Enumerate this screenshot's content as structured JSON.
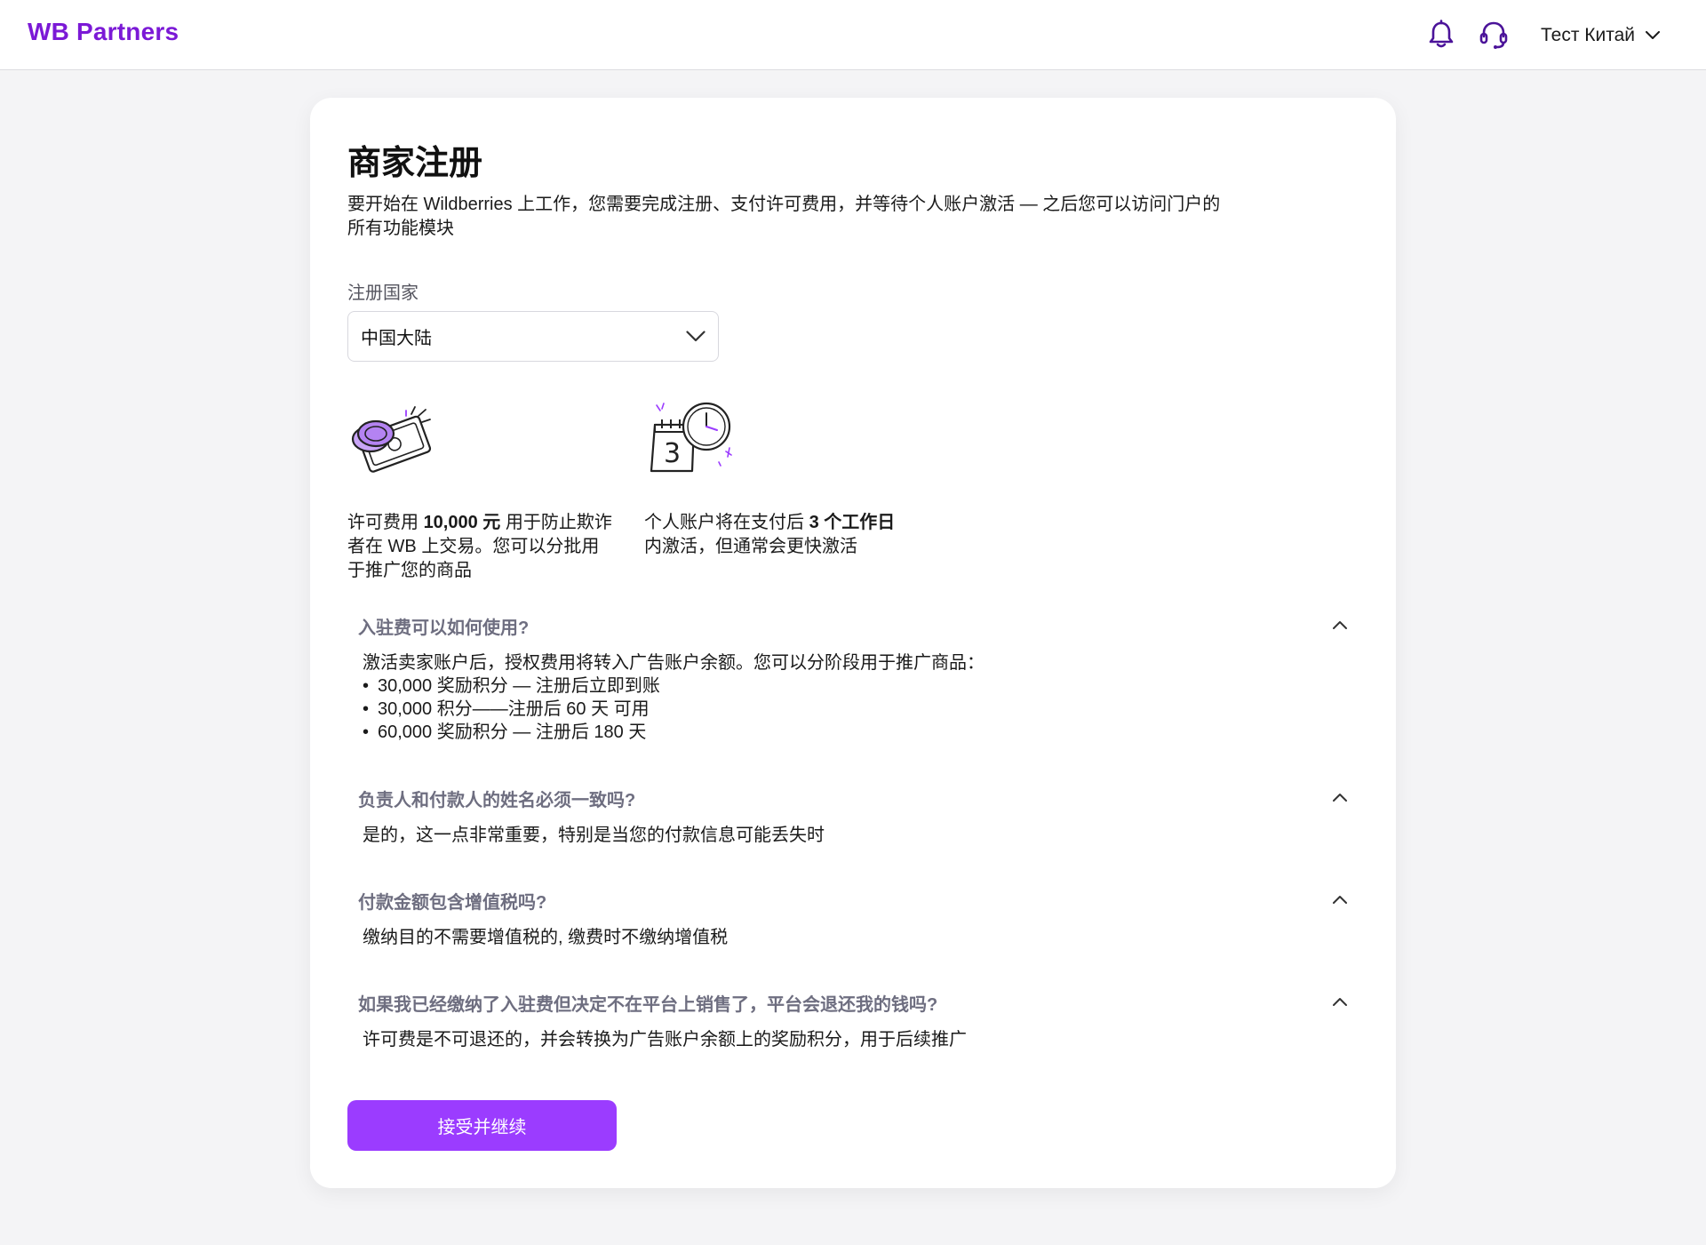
{
  "header": {
    "logo": "WB Partners",
    "user_name": "Тест Китай",
    "icons": [
      "bell-icon",
      "headset-support-icon",
      "chevron-down-icon"
    ]
  },
  "card": {
    "title": "商家注册",
    "intro": "要开始在 Wildberries 上工作，您需要完成注册、支付许可费用，并等待个人账户激活 — 之后您可以访问门户的所有功能模块",
    "country_label": "注册国家",
    "country_value": "中国大陆",
    "features": [
      {
        "icon": "coin-banknote-icon",
        "text_a": "许可费用 ",
        "text_b": "10,000 元",
        "text_c": " 用于防止欺诈者在 WB 上交易。您可以分批用于推广您的商品"
      },
      {
        "icon": "calendar-clock-icon",
        "text_a": "个人账户将在支付后 ",
        "text_b": "3 个工作日",
        "text_c": " 内激活，但通常会更快激活"
      }
    ],
    "faq": [
      {
        "question": "入驻费可以如何使用?",
        "answer_lead": "激活卖家账户后，授权费用将转入广告账户余额。您可以分阶段用于推广商品：",
        "answer_items": [
          "30,000 奖励积分 — 注册后立即到账",
          "30,000 积分——注册后 60 天 可用",
          "60,000 奖励积分 — 注册后 180 天"
        ]
      },
      {
        "question": "负责人和付款人的姓名必须一致吗?",
        "answer_lead": "是的，这一点非常重要，特别是当您的付款信息可能丢失时"
      },
      {
        "question": "付款金额包含增值税吗?",
        "answer_lead": "缴纳目的不需要增值税的, 缴费时不缴纳增值税"
      },
      {
        "question": "如果我已经缴纳了入驻费但决定不在平台上销售了，平台会退还我的钱吗?",
        "answer_lead": "许可费是不可退还的，并会转换为广告账户余额上的奖励积分，用于后续推广"
      }
    ],
    "accept_button": "接受并继续"
  },
  "colors": {
    "brand": "#7b19d6",
    "button": "#9b3cff",
    "question": "#6e6e80"
  }
}
